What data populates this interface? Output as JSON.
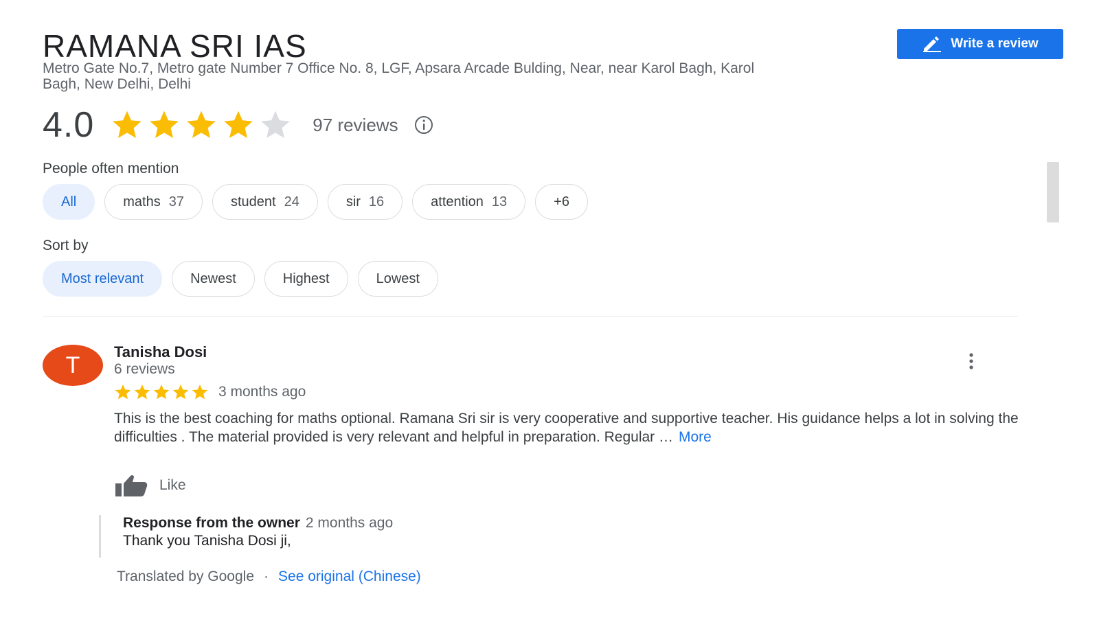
{
  "place": {
    "title": "RAMANA SRI IAS",
    "address": "Metro Gate No.7, Metro gate Number 7 Office No. 8, LGF, Apsara Arcade Bulding, Near, near Karol Bagh, Karol Bagh, New Delhi, Delhi"
  },
  "write_review": {
    "label": "Write a review",
    "icon": "pencil-icon"
  },
  "rating": {
    "value": "4.0",
    "stars_filled": 4,
    "stars_total": 5,
    "reviews_label": "97 reviews",
    "info_icon": "info-icon"
  },
  "mentions": {
    "label": "People often mention",
    "chips": [
      {
        "label": "All",
        "count": "",
        "selected": true
      },
      {
        "label": "maths",
        "count": "37",
        "selected": false
      },
      {
        "label": "student",
        "count": "24",
        "selected": false
      },
      {
        "label": "sir",
        "count": "16",
        "selected": false
      },
      {
        "label": "attention",
        "count": "13",
        "selected": false
      },
      {
        "label": "+6",
        "count": "",
        "selected": false
      }
    ]
  },
  "sort": {
    "label": "Sort by",
    "options": [
      {
        "label": "Most relevant",
        "selected": true
      },
      {
        "label": "Newest",
        "selected": false
      },
      {
        "label": "Highest",
        "selected": false
      },
      {
        "label": "Lowest",
        "selected": false
      }
    ]
  },
  "review": {
    "avatar_letter": "T",
    "avatar_color": "#e64a19",
    "author": "Tanisha Dosi",
    "author_meta": "6 reviews",
    "stars": 5,
    "date": "3 months ago",
    "text": "This is the  best coaching for maths optional. Ramana Sri sir is very cooperative and supportive teacher. His guidance helps a lot in solving the difficulties . The material provided is very relevant and helpful in preparation. Regular …",
    "more_label": "More",
    "like_label": "Like",
    "response": {
      "title": "Response from the owner",
      "date": "2 months ago",
      "text": "Thank you Tanisha Dosi ji,"
    },
    "translated_label": "Translated by Google",
    "separator": "·",
    "see_original_label": "See original (Chinese)"
  },
  "colors": {
    "accent": "#1a73e8",
    "star": "#fbbc04",
    "star_empty": "#dadce0",
    "chip_selected_bg": "#e8f0fe"
  }
}
